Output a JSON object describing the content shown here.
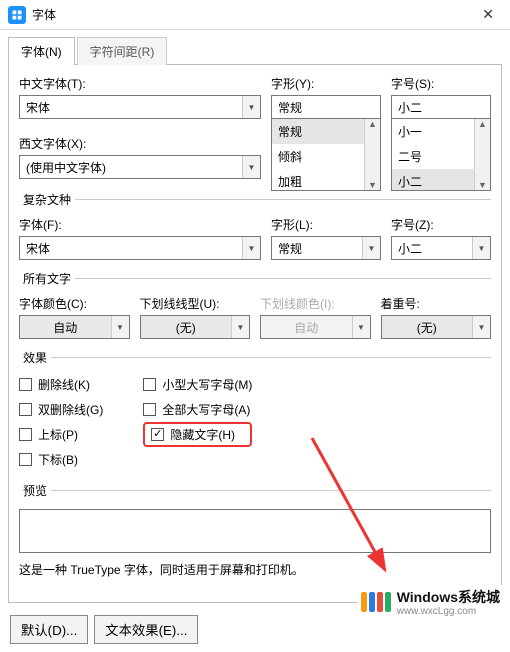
{
  "window": {
    "title": "字体",
    "close_label": "✕"
  },
  "tabs": {
    "font": "字体(N)",
    "spacing": "字符间距(R)"
  },
  "main": {
    "cn_font_label": "中文字体(T):",
    "cn_font_value": "宋体",
    "west_font_label": "西文字体(X):",
    "west_font_value": "(使用中文字体)",
    "style_label": "字形(Y):",
    "style_value": "常规",
    "style_list": [
      "常规",
      "倾斜",
      "加粗"
    ],
    "size_label": "字号(S):",
    "size_value": "小二",
    "size_list": [
      "小一",
      "二号",
      "小二"
    ]
  },
  "complex": {
    "legend": "复杂文种",
    "font_label": "字体(F):",
    "font_value": "宋体",
    "style_label": "字形(L):",
    "style_value": "常规",
    "size_label": "字号(Z):",
    "size_value": "小二"
  },
  "alltext": {
    "legend": "所有文字",
    "color_label": "字体颜色(C):",
    "color_value": "自动",
    "underline_label": "下划线线型(U):",
    "underline_value": "(无)",
    "ul_color_label": "下划线颜色(I):",
    "ul_color_value": "自动",
    "emphasis_label": "着重号:",
    "emphasis_value": "(无)"
  },
  "effects": {
    "legend": "效果",
    "strike": "删除线(K)",
    "dstrike": "双删除线(G)",
    "superscript": "上标(P)",
    "subscript": "下标(B)",
    "smallcaps": "小型大写字母(M)",
    "allcaps": "全部大写字母(A)",
    "hidden": "隐藏文字(H)"
  },
  "preview": {
    "legend": "预览",
    "note": "这是一种 TrueType 字体，同时适用于屏幕和打印机。"
  },
  "buttons": {
    "default": "默认(D)...",
    "texteffects": "文本效果(E)..."
  },
  "watermark": {
    "line1": "Windows系统城",
    "line2": "www.wxcLgg.com"
  }
}
